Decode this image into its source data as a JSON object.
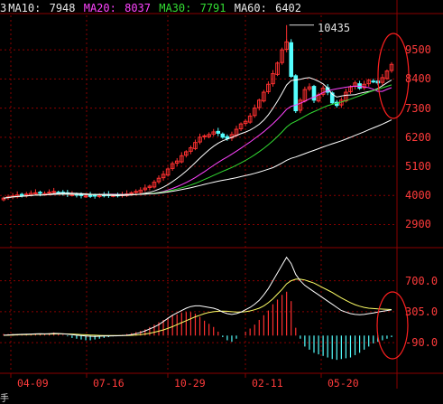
{
  "header": {
    "left_fragment": "3",
    "ma10_label": "MA10:",
    "ma10_value": "7948",
    "ma20_label": "MA20:",
    "ma20_value": "8037",
    "ma30_label": "MA30:",
    "ma30_value": "7791",
    "ma60_label": "MA60:",
    "ma60_value": "6402"
  },
  "peak_label": "10435",
  "left_edge_glyph": "手",
  "colors": {
    "background": "#000000",
    "grid": "#8a0000",
    "axis_text": "#ff3b3b",
    "candle_up": "#ff3030",
    "candle_down": "#55ffff",
    "ma10": "#ffffff",
    "ma20": "#ff44ff",
    "ma30": "#33dd33",
    "ma60": "#ffffff",
    "dif": "#ffffff",
    "dea": "#ffff66",
    "annotation_circle": "#ff2020"
  },
  "chart_data": [
    {
      "type": "candlestick",
      "title": "",
      "y_ticks": [
        "9500",
        "8400",
        "7300",
        "6200",
        "5100",
        "4000",
        "2900"
      ],
      "ylim": [
        2200,
        10700
      ],
      "x_ticks": [
        "04-09",
        "07-16",
        "10-29",
        "02-11",
        "05-20"
      ],
      "peak_value": 10435,
      "close": [
        3900,
        3950,
        3980,
        4020,
        4010,
        4050,
        4080,
        4100,
        4080,
        4070,
        4120,
        4150,
        4100,
        4080,
        4050,
        4030,
        4010,
        4000,
        3980,
        3990,
        3990,
        4000,
        4010,
        4020,
        4000,
        4010,
        4030,
        4060,
        4100,
        4150,
        4200,
        4280,
        4350,
        4500,
        4650,
        4800,
        5000,
        5200,
        5300,
        5500,
        5650,
        5800,
        6000,
        6200,
        6250,
        6300,
        6400,
        6350,
        6200,
        6150,
        6300,
        6500,
        6700,
        6800,
        7000,
        7300,
        7600,
        7900,
        8200,
        8600,
        9000,
        9500,
        9800,
        8500,
        7200,
        7600,
        8000,
        8100,
        7600,
        7800,
        8050,
        7900,
        7500,
        7400,
        7600,
        7900,
        8100,
        8250,
        8050,
        8200,
        8350,
        8300,
        8250,
        8450,
        8700,
        8950
      ],
      "ma_lines": [
        {
          "name": "MA10",
          "values_ref": "computed from close",
          "last": 7948
        },
        {
          "name": "MA20",
          "values_ref": "computed from close",
          "last": 8037
        },
        {
          "name": "MA30",
          "values_ref": "computed from close",
          "last": 7791
        },
        {
          "name": "MA60",
          "values_ref": "computed from close",
          "last": 6402
        }
      ]
    },
    {
      "type": "bar",
      "title": "",
      "y_ticks": [
        "700.0",
        "305.0",
        "-90.0"
      ],
      "ylim": [
        -470,
        1100
      ],
      "dif": [
        5,
        8,
        12,
        14,
        16,
        18,
        20,
        22,
        23,
        22,
        24,
        28,
        26,
        22,
        18,
        12,
        5,
        0,
        -5,
        -8,
        -10,
        -8,
        -6,
        -5,
        -4,
        -3,
        0,
        5,
        12,
        24,
        40,
        60,
        85,
        110,
        140,
        180,
        220,
        260,
        290,
        320,
        350,
        370,
        380,
        380,
        370,
        360,
        350,
        330,
        300,
        280,
        270,
        280,
        300,
        330,
        360,
        400,
        450,
        520,
        600,
        700,
        800,
        900,
        1000,
        920,
        780,
        700,
        640,
        600,
        560,
        520,
        480,
        440,
        400,
        360,
        320,
        300,
        280,
        270,
        265,
        270,
        280,
        290,
        300,
        310,
        320,
        330
      ],
      "dea": [
        3,
        5,
        7,
        9,
        11,
        13,
        15,
        17,
        18,
        19,
        20,
        21,
        22,
        22,
        21,
        19,
        16,
        13,
        10,
        7,
        4,
        2,
        1,
        0,
        0,
        0,
        0,
        1,
        3,
        7,
        12,
        20,
        30,
        42,
        56,
        72,
        92,
        114,
        140,
        165,
        190,
        215,
        240,
        260,
        280,
        295,
        305,
        310,
        312,
        310,
        305,
        300,
        300,
        305,
        315,
        330,
        350,
        380,
        420,
        470,
        530,
        590,
        660,
        700,
        720,
        720,
        710,
        690,
        670,
        640,
        610,
        580,
        550,
        515,
        480,
        450,
        420,
        395,
        375,
        360,
        350,
        345,
        340,
        338,
        335,
        332
      ],
      "histogram": [
        20,
        20,
        20,
        20,
        20,
        20,
        20,
        20,
        20,
        20,
        30,
        40,
        30,
        10,
        -10,
        -30,
        -40,
        -50,
        -60,
        -60,
        -50,
        -40,
        -30,
        -20,
        -10,
        0,
        10,
        20,
        30,
        45,
        60,
        80,
        110,
        140,
        170,
        200,
        230,
        260,
        270,
        290,
        300,
        300,
        280,
        240,
        190,
        150,
        110,
        50,
        -20,
        -60,
        -80,
        -40,
        0,
        50,
        90,
        140,
        200,
        260,
        320,
        400,
        460,
        520,
        560,
        440,
        100,
        -40,
        -140,
        -180,
        -220,
        -240,
        -260,
        -280,
        -300,
        -310,
        -300,
        -290,
        -280,
        -250,
        -220,
        -180,
        -140,
        -100,
        -80,
        -60,
        -40,
        -20
      ]
    }
  ]
}
